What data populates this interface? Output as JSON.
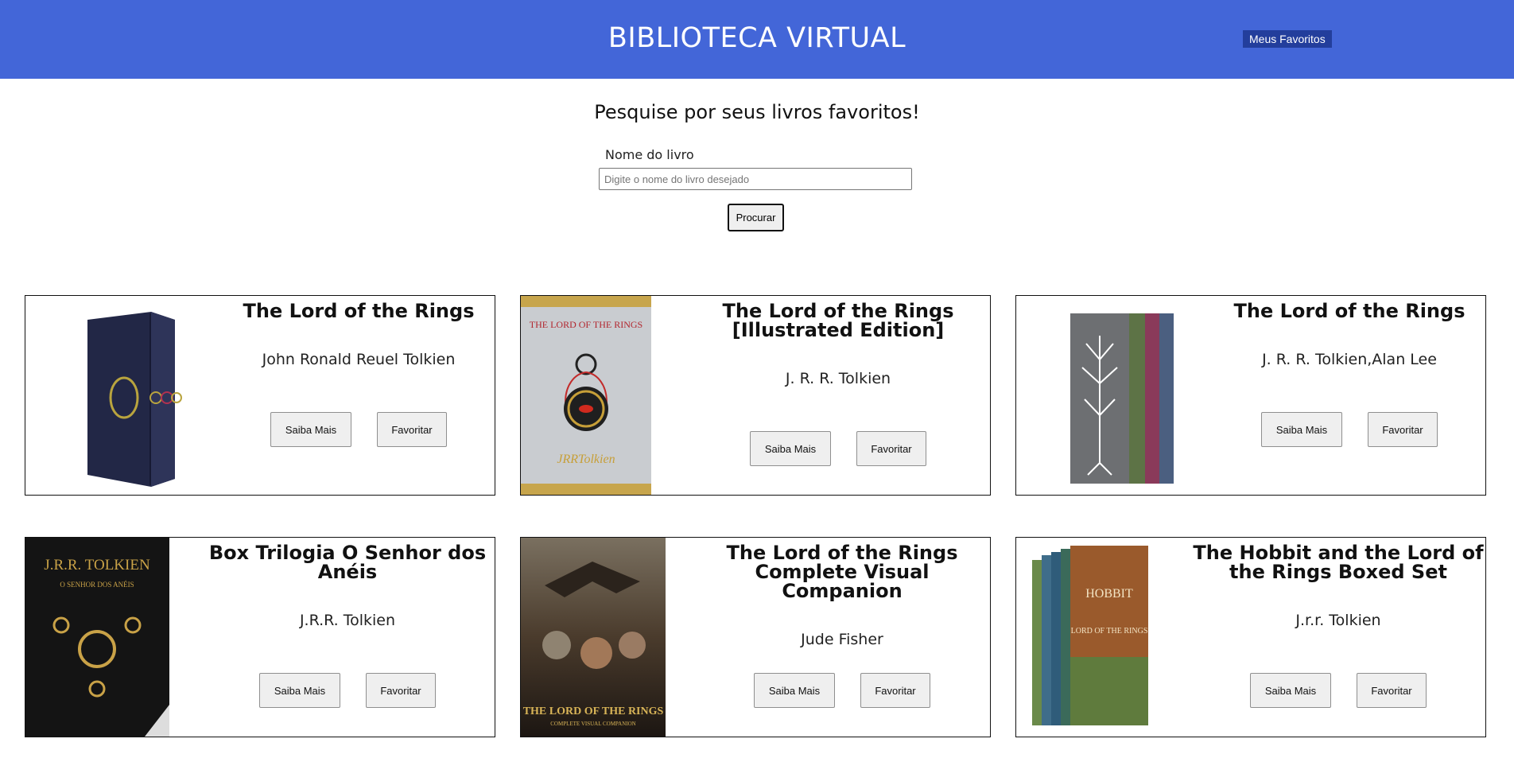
{
  "header": {
    "title": "BIBLIOTECA VIRTUAL",
    "favorites_label": "Meus Favoritos",
    "color": "#4366d8"
  },
  "search": {
    "heading": "Pesquise por seus livros favoritos!",
    "label": "Nome do livro",
    "value": "",
    "placeholder": "Digite o nome do livro desejado",
    "button_label": "Procurar"
  },
  "books": [
    {
      "title": "The Lord of the Rings",
      "author": "John Ronald Reuel Tolkien",
      "more_label": "Saiba Mais",
      "fav_label": "Favoritar"
    },
    {
      "title": "The Lord of the Rings [Illustrated Edition]",
      "author": "J. R. R. Tolkien",
      "more_label": "Saiba Mais",
      "fav_label": "Favoritar",
      "cover_text": "THE LORD OF THE RINGS"
    },
    {
      "title": "The Lord of the Rings",
      "author": "J. R. R. Tolkien,Alan Lee",
      "more_label": "Saiba Mais",
      "fav_label": "Favoritar"
    },
    {
      "title": "Box Trilogia O Senhor dos Anéis",
      "author": "J.R.R. Tolkien",
      "more_label": "Saiba Mais",
      "fav_label": "Favoritar",
      "cover_text": "J.R.R. TOLKIEN",
      "cover_subtext": "O SENHOR DOS ANÉIS"
    },
    {
      "title": "The Lord of the Rings Complete Visual Companion",
      "author": "Jude Fisher",
      "more_label": "Saiba Mais",
      "fav_label": "Favoritar",
      "cover_text": "THE LORD OF THE RINGS",
      "cover_subtext": "COMPLETE VISUAL COMPANION"
    },
    {
      "title": "The Hobbit and the Lord of the Rings Boxed Set",
      "author": "J.r.r. Tolkien",
      "more_label": "Saiba Mais",
      "fav_label": "Favoritar",
      "cover_text": "HOBBIT",
      "cover_subtext": "LORD OF THE RINGS"
    }
  ]
}
